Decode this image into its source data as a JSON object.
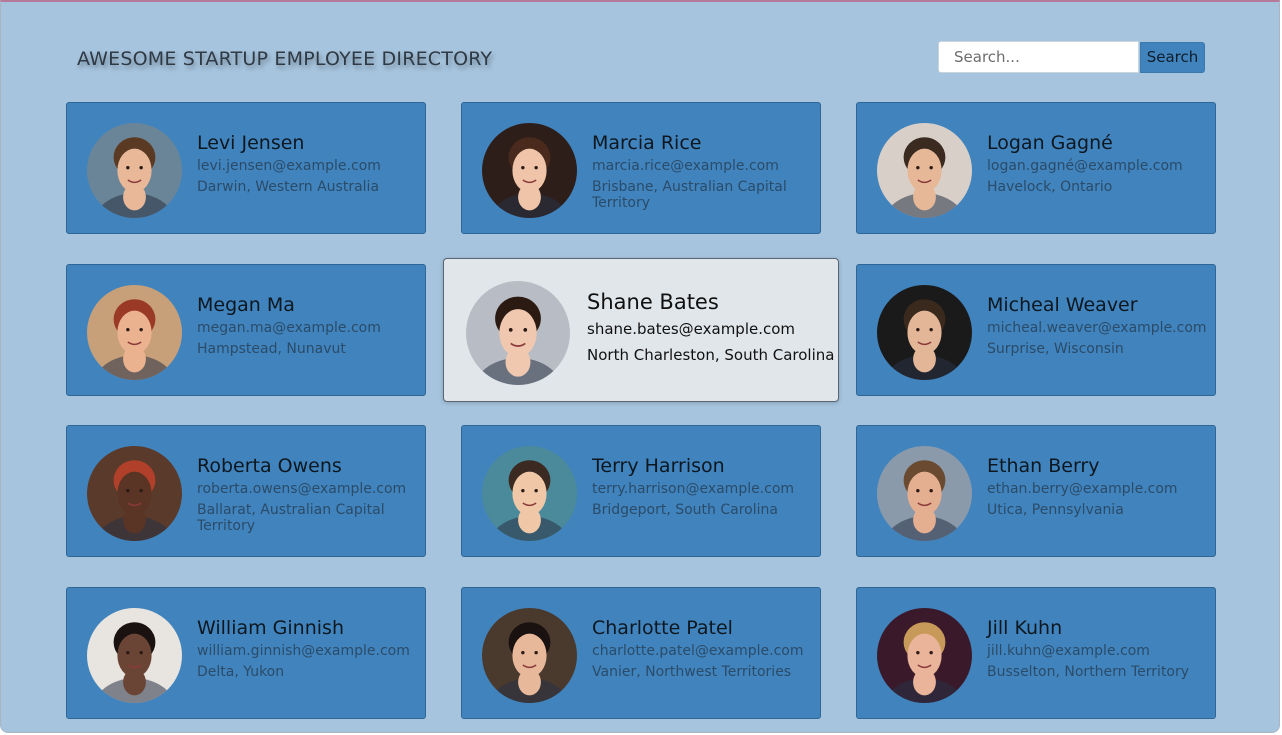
{
  "header": {
    "title": "AWESOME STARTUP EMPLOYEE DIRECTORY"
  },
  "search": {
    "placeholder": "Search...",
    "button_label": "Search"
  },
  "employees": [
    {
      "name": "Levi Jensen",
      "email": "levi.jensen@example.com",
      "location": "Darwin, Western Australia",
      "avatar": "person-photo",
      "bg": "#6b8598",
      "skin": "#e8b898",
      "hair": "#5a3a22"
    },
    {
      "name": "Marcia Rice",
      "email": "marcia.rice@example.com",
      "location": "Brisbane, Australian Capital Territory",
      "avatar": "person-photo",
      "bg": "#2e1e1a",
      "skin": "#f0c4a8",
      "hair": "#4a2a1c"
    },
    {
      "name": "Logan Gagné",
      "email": "logan.gagné@example.com",
      "location": "Havelock, Ontario",
      "avatar": "person-photo",
      "bg": "#d8d0c8",
      "skin": "#e6b898",
      "hair": "#3a2a20"
    },
    {
      "name": "Megan Ma",
      "email": "megan.ma@example.com",
      "location": "Hampstead, Nunavut",
      "avatar": "person-photo",
      "bg": "#c7a07a",
      "skin": "#eab28e",
      "hair": "#9a3a26"
    },
    {
      "name": "Shane Bates",
      "email": "shane.bates@example.com",
      "location": "North Charleston, South Carolina",
      "avatar": "person-photo",
      "bg": "#b8bcc4",
      "skin": "#f0c8b0",
      "hair": "#2a1a12"
    },
    {
      "name": "Micheal Weaver",
      "email": "micheal.weaver@example.com",
      "location": "Surprise, Wisconsin",
      "avatar": "person-photo",
      "bg": "#1a1a1a",
      "skin": "#e4b698",
      "hair": "#3a2a1e"
    },
    {
      "name": "Roberta Owens",
      "email": "roberta.owens@example.com",
      "location": "Ballarat, Australian Capital Territory",
      "avatar": "person-photo",
      "bg": "#5a3a2a",
      "skin": "#5a3424",
      "hair": "#b0402a"
    },
    {
      "name": "Terry Harrison",
      "email": "terry.harrison@example.com",
      "location": "Bridgeport, South Carolina",
      "avatar": "person-photo",
      "bg": "#4a8a9a",
      "skin": "#f0c8a8",
      "hair": "#3a2a22"
    },
    {
      "name": "Ethan Berry",
      "email": "ethan.berry@example.com",
      "location": "Utica, Pennsylvania",
      "avatar": "person-photo",
      "bg": "#8a9aaa",
      "skin": "#e4ae90",
      "hair": "#6a4a30"
    },
    {
      "name": "William Ginnish",
      "email": "william.ginnish@example.com",
      "location": "Delta, Yukon",
      "avatar": "person-photo",
      "bg": "#e8e4e0",
      "skin": "#6a4434",
      "hair": "#1a1210"
    },
    {
      "name": "Charlotte Patel",
      "email": "charlotte.patel@example.com",
      "location": "Vanier, Northwest Territories",
      "avatar": "person-photo",
      "bg": "#4a3a2e",
      "skin": "#e8b89a",
      "hair": "#1a1210"
    },
    {
      "name": "Jill Kuhn",
      "email": "jill.kuhn@example.com",
      "location": "Busselton, Northern Territory",
      "avatar": "person-photo",
      "bg": "#3a1a2a",
      "skin": "#eab49a",
      "hair": "#c89a5a"
    }
  ]
}
